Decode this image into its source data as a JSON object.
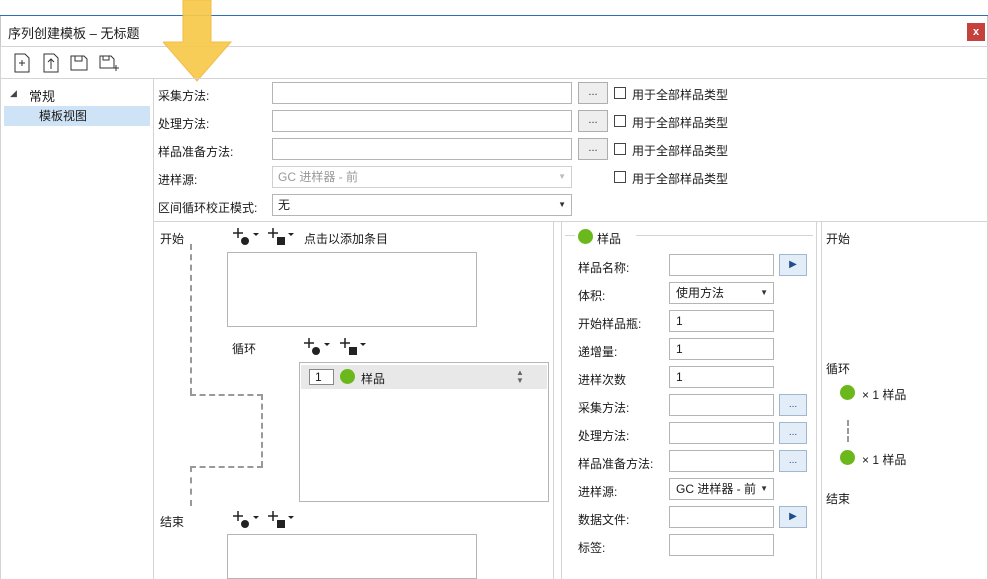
{
  "window": {
    "title": "序列创建模板 – 无标题",
    "close_label": "x"
  },
  "toolbar": {
    "icons": [
      "new-icon",
      "import-icon",
      "save-icon",
      "save-as-icon"
    ]
  },
  "tree": {
    "root_label": "常规",
    "child_label": "模板视图"
  },
  "form": {
    "acquisition_label": "采集方法:",
    "processing_label": "处理方法:",
    "sample_prep_label": "样品准备方法:",
    "injection_source_label": "进样源:",
    "injection_source_value": "GC 进样器 - 前",
    "bracket_label": "区间循环校正模式:",
    "bracket_value": "无",
    "browse_label": "...",
    "apply_all_label": "用于全部样品类型"
  },
  "builder": {
    "start_label": "开始",
    "add_hint": "点击以添加条目",
    "loop_label": "循环",
    "end_label": "结束",
    "loop_item_index": "1",
    "loop_item_label": "样品"
  },
  "props": {
    "header": "样品",
    "sample_name_label": "样品名称:",
    "volume_label": "体积:",
    "volume_value": "使用方法",
    "start_vial_label": "开始样品瓶:",
    "start_vial_value": "1",
    "increment_label": "递增量:",
    "increment_value": "1",
    "injections_label": "进样次数",
    "injections_value": "1",
    "acq_label": "采集方法:",
    "proc_label": "处理方法:",
    "prep_label": "样品准备方法:",
    "source_label": "进样源:",
    "source_value": "GC 进样器 - 前",
    "datafile_label": "数据文件:",
    "tag_label": "标签:",
    "browse_label": "..."
  },
  "preview": {
    "start_label": "开始",
    "loop_label": "循环",
    "item1": "× 1  样品",
    "item2": "× 1  样品",
    "end_label": "结束"
  },
  "colors": {
    "accent": "#2e6fb5",
    "close": "#c4413e",
    "sample_dot": "#6bb81c",
    "highlight_arrow": "#f7c94a"
  }
}
